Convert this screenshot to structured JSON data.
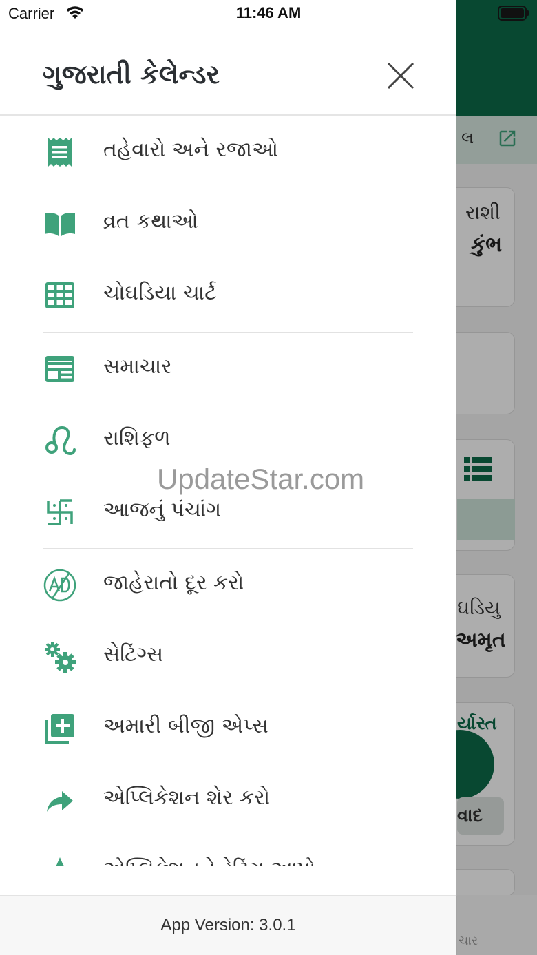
{
  "status_bar": {
    "carrier": "Carrier",
    "time": "11:46 AM"
  },
  "background": {
    "strip_text": "લ",
    "card1_line1": "રાશી",
    "card1_line2": "કુંભ",
    "card2_line1": "ઘડિયુ",
    "card2_line2": "અમૃત",
    "green_text": "ર્યાસ્ત",
    "chip_text": "વાદ",
    "bottom_text": "ચાર"
  },
  "drawer": {
    "title": "ગુજરાતી કેલેન્ડર",
    "items": [
      {
        "label": "તહેવારો અને રજાઓ",
        "icon": "receipt-icon"
      },
      {
        "label": "વ્રત કથાઓ",
        "icon": "book-open-icon"
      },
      {
        "label": "ચોઘડિયા ચાર્ટ",
        "icon": "table-grid-icon"
      },
      {
        "label": "સમાચાર",
        "icon": "newspaper-icon"
      },
      {
        "label": "રાશિફળ",
        "icon": "leo-zodiac-icon"
      },
      {
        "label": "આજનું પંચાંગ",
        "icon": "swastik-icon"
      },
      {
        "label": "જાહેરાતો દૂર કરો",
        "icon": "no-ads-icon"
      },
      {
        "label": "સેટિંગ્સ",
        "icon": "gears-icon"
      },
      {
        "label": "અમારી બીજી એપ્સ",
        "icon": "add-box-icon"
      },
      {
        "label": "એપ્લિકેશન શેર કરો",
        "icon": "share-arrow-icon"
      },
      {
        "label": "એપ્લિકેશનને રેટિંગ આપો",
        "icon": "star-icon"
      }
    ],
    "version": "App Version: 3.0.1"
  },
  "watermark": "UpdateStar.com",
  "colors": {
    "accent": "#3fa27b",
    "header_bg": "#0c6b49",
    "text": "#333333"
  }
}
